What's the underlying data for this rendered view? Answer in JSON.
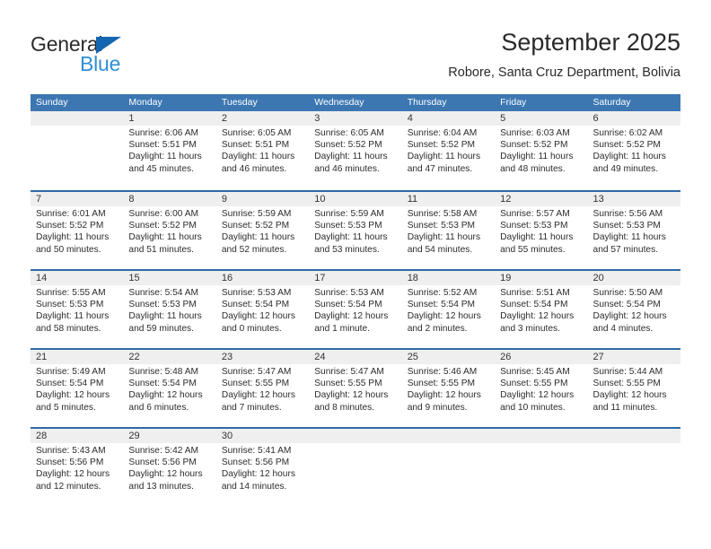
{
  "logo": {
    "primary_text": "General",
    "secondary_text": "Blue",
    "primary_color": "#2b2b2b",
    "secondary_color": "#2f8ed6",
    "triangle_color": "#1466b0"
  },
  "header": {
    "title": "September 2025",
    "subtitle": "Robore, Santa Cruz Department, Bolivia"
  },
  "theme": {
    "header_bg": "#3c77b2",
    "header_text": "#ffffff",
    "row_divider": "#2f6aa8",
    "daynum_band": "#efefef",
    "body_text": "#2c2c2c"
  },
  "calendar": {
    "weekdays": [
      "Sunday",
      "Monday",
      "Tuesday",
      "Wednesday",
      "Thursday",
      "Friday",
      "Saturday"
    ],
    "weeks": [
      [
        {
          "day": "",
          "lines": []
        },
        {
          "day": "1",
          "lines": [
            "Sunrise: 6:06 AM",
            "Sunset: 5:51 PM",
            "Daylight: 11 hours",
            "and 45 minutes."
          ]
        },
        {
          "day": "2",
          "lines": [
            "Sunrise: 6:05 AM",
            "Sunset: 5:51 PM",
            "Daylight: 11 hours",
            "and 46 minutes."
          ]
        },
        {
          "day": "3",
          "lines": [
            "Sunrise: 6:05 AM",
            "Sunset: 5:52 PM",
            "Daylight: 11 hours",
            "and 46 minutes."
          ]
        },
        {
          "day": "4",
          "lines": [
            "Sunrise: 6:04 AM",
            "Sunset: 5:52 PM",
            "Daylight: 11 hours",
            "and 47 minutes."
          ]
        },
        {
          "day": "5",
          "lines": [
            "Sunrise: 6:03 AM",
            "Sunset: 5:52 PM",
            "Daylight: 11 hours",
            "and 48 minutes."
          ]
        },
        {
          "day": "6",
          "lines": [
            "Sunrise: 6:02 AM",
            "Sunset: 5:52 PM",
            "Daylight: 11 hours",
            "and 49 minutes."
          ]
        }
      ],
      [
        {
          "day": "7",
          "lines": [
            "Sunrise: 6:01 AM",
            "Sunset: 5:52 PM",
            "Daylight: 11 hours",
            "and 50 minutes."
          ]
        },
        {
          "day": "8",
          "lines": [
            "Sunrise: 6:00 AM",
            "Sunset: 5:52 PM",
            "Daylight: 11 hours",
            "and 51 minutes."
          ]
        },
        {
          "day": "9",
          "lines": [
            "Sunrise: 5:59 AM",
            "Sunset: 5:52 PM",
            "Daylight: 11 hours",
            "and 52 minutes."
          ]
        },
        {
          "day": "10",
          "lines": [
            "Sunrise: 5:59 AM",
            "Sunset: 5:53 PM",
            "Daylight: 11 hours",
            "and 53 minutes."
          ]
        },
        {
          "day": "11",
          "lines": [
            "Sunrise: 5:58 AM",
            "Sunset: 5:53 PM",
            "Daylight: 11 hours",
            "and 54 minutes."
          ]
        },
        {
          "day": "12",
          "lines": [
            "Sunrise: 5:57 AM",
            "Sunset: 5:53 PM",
            "Daylight: 11 hours",
            "and 55 minutes."
          ]
        },
        {
          "day": "13",
          "lines": [
            "Sunrise: 5:56 AM",
            "Sunset: 5:53 PM",
            "Daylight: 11 hours",
            "and 57 minutes."
          ]
        }
      ],
      [
        {
          "day": "14",
          "lines": [
            "Sunrise: 5:55 AM",
            "Sunset: 5:53 PM",
            "Daylight: 11 hours",
            "and 58 minutes."
          ]
        },
        {
          "day": "15",
          "lines": [
            "Sunrise: 5:54 AM",
            "Sunset: 5:53 PM",
            "Daylight: 11 hours",
            "and 59 minutes."
          ]
        },
        {
          "day": "16",
          "lines": [
            "Sunrise: 5:53 AM",
            "Sunset: 5:54 PM",
            "Daylight: 12 hours",
            "and 0 minutes."
          ]
        },
        {
          "day": "17",
          "lines": [
            "Sunrise: 5:53 AM",
            "Sunset: 5:54 PM",
            "Daylight: 12 hours",
            "and 1 minute."
          ]
        },
        {
          "day": "18",
          "lines": [
            "Sunrise: 5:52 AM",
            "Sunset: 5:54 PM",
            "Daylight: 12 hours",
            "and 2 minutes."
          ]
        },
        {
          "day": "19",
          "lines": [
            "Sunrise: 5:51 AM",
            "Sunset: 5:54 PM",
            "Daylight: 12 hours",
            "and 3 minutes."
          ]
        },
        {
          "day": "20",
          "lines": [
            "Sunrise: 5:50 AM",
            "Sunset: 5:54 PM",
            "Daylight: 12 hours",
            "and 4 minutes."
          ]
        }
      ],
      [
        {
          "day": "21",
          "lines": [
            "Sunrise: 5:49 AM",
            "Sunset: 5:54 PM",
            "Daylight: 12 hours",
            "and 5 minutes."
          ]
        },
        {
          "day": "22",
          "lines": [
            "Sunrise: 5:48 AM",
            "Sunset: 5:54 PM",
            "Daylight: 12 hours",
            "and 6 minutes."
          ]
        },
        {
          "day": "23",
          "lines": [
            "Sunrise: 5:47 AM",
            "Sunset: 5:55 PM",
            "Daylight: 12 hours",
            "and 7 minutes."
          ]
        },
        {
          "day": "24",
          "lines": [
            "Sunrise: 5:47 AM",
            "Sunset: 5:55 PM",
            "Daylight: 12 hours",
            "and 8 minutes."
          ]
        },
        {
          "day": "25",
          "lines": [
            "Sunrise: 5:46 AM",
            "Sunset: 5:55 PM",
            "Daylight: 12 hours",
            "and 9 minutes."
          ]
        },
        {
          "day": "26",
          "lines": [
            "Sunrise: 5:45 AM",
            "Sunset: 5:55 PM",
            "Daylight: 12 hours",
            "and 10 minutes."
          ]
        },
        {
          "day": "27",
          "lines": [
            "Sunrise: 5:44 AM",
            "Sunset: 5:55 PM",
            "Daylight: 12 hours",
            "and 11 minutes."
          ]
        }
      ],
      [
        {
          "day": "28",
          "lines": [
            "Sunrise: 5:43 AM",
            "Sunset: 5:56 PM",
            "Daylight: 12 hours",
            "and 12 minutes."
          ]
        },
        {
          "day": "29",
          "lines": [
            "Sunrise: 5:42 AM",
            "Sunset: 5:56 PM",
            "Daylight: 12 hours",
            "and 13 minutes."
          ]
        },
        {
          "day": "30",
          "lines": [
            "Sunrise: 5:41 AM",
            "Sunset: 5:56 PM",
            "Daylight: 12 hours",
            "and 14 minutes."
          ]
        },
        {
          "day": "",
          "lines": []
        },
        {
          "day": "",
          "lines": []
        },
        {
          "day": "",
          "lines": []
        },
        {
          "day": "",
          "lines": []
        }
      ]
    ]
  }
}
